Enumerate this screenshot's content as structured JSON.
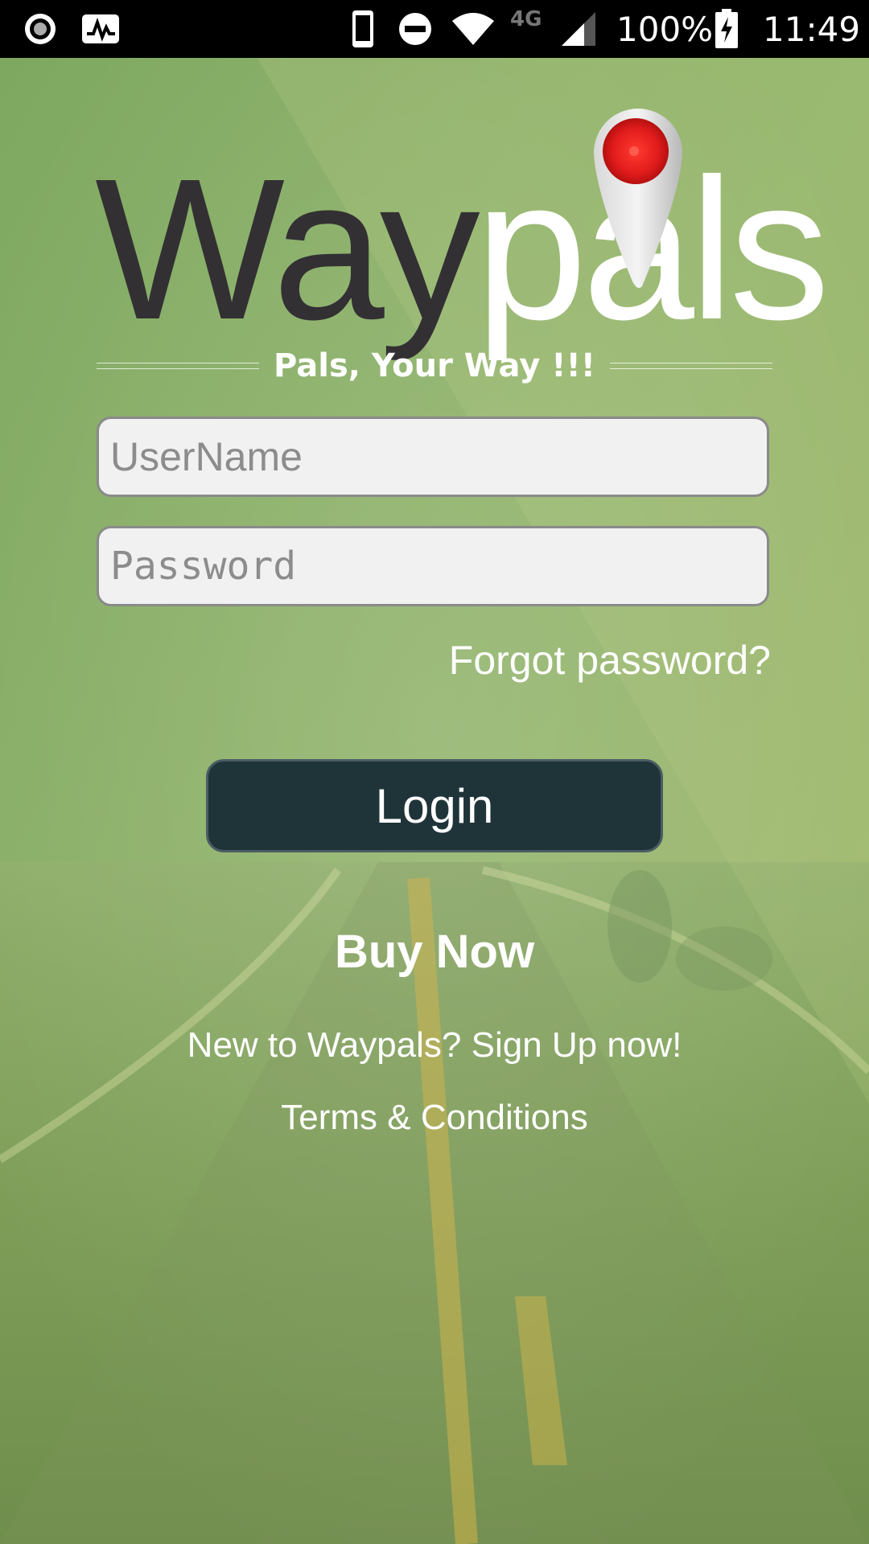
{
  "status_bar": {
    "battery_text": "100%",
    "network_type": "4G",
    "time": "11:49",
    "icons": [
      "record-icon",
      "activity-icon",
      "phone-device-icon",
      "do-not-disturb-icon",
      "wifi-icon",
      "cell-signal-icon",
      "battery-charging-icon"
    ]
  },
  "logo": {
    "brand_dark": "Way",
    "brand_light": "pals",
    "pin_icon": "map-pin-icon",
    "tagline": "Pals, Your Way !!!"
  },
  "form": {
    "username_placeholder": "UserName",
    "username_value": "",
    "password_placeholder": "Password",
    "password_value": "",
    "forgot_label": "Forgot password?",
    "login_label": "Login"
  },
  "links": {
    "buy_now": "Buy Now",
    "signup": "New to Waypals? Sign Up now!",
    "terms": "Terms & Conditions"
  },
  "colors": {
    "background_green": "#8aab66",
    "login_button": "#1f3439",
    "logo_dark": "#333033",
    "pin_red": "#e02020"
  }
}
